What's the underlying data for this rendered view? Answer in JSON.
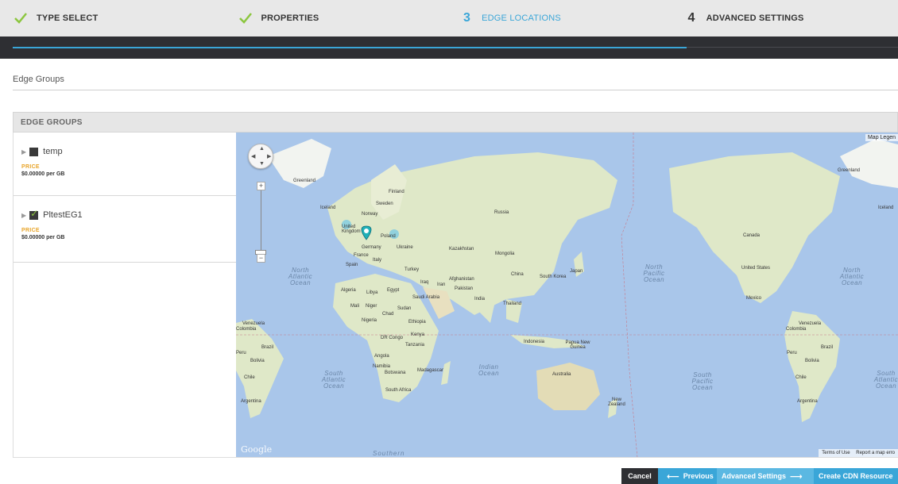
{
  "steps": [
    {
      "label": "TYPE SELECT",
      "state": "done"
    },
    {
      "label": "PROPERTIES",
      "state": "done"
    },
    {
      "number": "3",
      "label": "EDGE LOCATIONS",
      "state": "active"
    },
    {
      "number": "4",
      "label": "ADVANCED SETTINGS",
      "state": "todo"
    }
  ],
  "colors": {
    "accent": "#3aa6d8",
    "check": "#8cc63f",
    "dark": "#2e2f33",
    "price_label": "#e8a52b",
    "ocean": "#a9c6ea",
    "land": "#dfe8c8"
  },
  "section": {
    "title": "Edge Groups"
  },
  "panel": {
    "header": "EDGE GROUPS",
    "groups": [
      {
        "name": "temp",
        "checked": false,
        "price_label": "PRICE",
        "price": "$0.00000 per GB"
      },
      {
        "name": "PltestEG1",
        "checked": true,
        "price_label": "PRICE",
        "price": "$0.00000 per GB"
      }
    ]
  },
  "map": {
    "legend": "Map Legen",
    "provider": "Google",
    "terms": "Terms of Use",
    "report": "Report a map erro",
    "zoom_in": "+",
    "zoom_out": "−",
    "labels": {
      "greenland_left": "Greenland",
      "greenland_right": "Greenland",
      "iceland_left": "Iceland",
      "iceland_right": "Iceland",
      "finland": "Finland",
      "sweden": "Sweden",
      "norway": "Norway",
      "russia": "Russia",
      "uk": "United Kingdom",
      "poland": "Poland",
      "germany": "Germany",
      "ukraine": "Ukraine",
      "france": "France",
      "italy": "Italy",
      "spain": "Spain",
      "kazakhstan": "Kazakhstan",
      "mongolia": "Mongolia",
      "turkey": "Turkey",
      "china": "China",
      "south_korea": "South Korea",
      "japan": "Japan",
      "iraq": "Iraq",
      "iran": "Iran",
      "afghanistan": "Afghanistan",
      "pakistan": "Pakistan",
      "algeria": "Algeria",
      "libya": "Libya",
      "egypt": "Egypt",
      "saudi": "Saudi Arabia",
      "india": "India",
      "thailand": "Thailand",
      "mali": "Mali",
      "niger": "Niger",
      "sudan": "Sudan",
      "chad": "Chad",
      "nigeria": "Nigeria",
      "ethiopia": "Ethiopia",
      "venezuela_left": "Venezuela",
      "colombia_left": "Colombia",
      "dr_congo": "DR Congo",
      "kenya": "Kenya",
      "tanzania": "Tanzania",
      "indonesia": "Indonesia",
      "png": "Papua New Guinea",
      "brazil_left": "Brazil",
      "peru_left": "Peru",
      "bolivia_left": "Bolivia",
      "angola": "Angola",
      "namibia": "Namibia",
      "botswana": "Botswana",
      "madagascar": "Madagascar",
      "australia": "Australia",
      "chile_left": "Chile",
      "argentina_left": "Argentina",
      "south_africa": "South Africa",
      "new_zealand": "New Zealand",
      "canada": "Canada",
      "united_states": "United States",
      "mexico": "Mexico",
      "venezuela_right": "Venezuela",
      "colombia_right": "Colombia",
      "brazil_right": "Brazil",
      "peru_right": "Peru",
      "bolivia_right": "Bolivia",
      "chile_right": "Chile",
      "argentina_right": "Argentina"
    },
    "oceans": {
      "north_atlantic_left": "North Atlantic Ocean",
      "north_pacific": "North Pacific Ocean",
      "north_atlantic_right": "North Atlantic Ocean",
      "south_atlantic_left": "South Atlantic Ocean",
      "indian": "Indian Ocean",
      "south_pacific": "South Pacific Ocean",
      "south_atlantic_right": "South Atlantic Ocean",
      "southern": "Southern"
    }
  },
  "buttons": {
    "cancel": "Cancel",
    "previous": "Previous",
    "advanced": "Advanced Settings",
    "create": "Create CDN Resource"
  }
}
